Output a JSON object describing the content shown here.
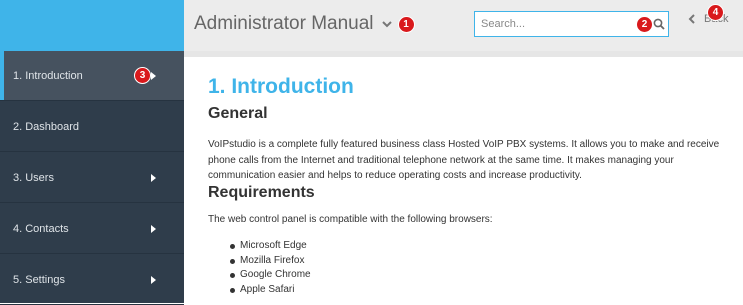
{
  "header": {
    "title": "Administrator Manual",
    "search_placeholder": "Search...",
    "back_label": "Back"
  },
  "badges": [
    "1",
    "2",
    "3",
    "4"
  ],
  "sidebar": {
    "items": [
      {
        "label": "1. Introduction",
        "active": true,
        "has_arrow": true
      },
      {
        "label": "2. Dashboard",
        "active": false,
        "has_arrow": false
      },
      {
        "label": "3. Users",
        "active": false,
        "has_arrow": true
      },
      {
        "label": "4. Contacts",
        "active": false,
        "has_arrow": true
      },
      {
        "label": "5. Settings",
        "active": false,
        "has_arrow": true
      }
    ]
  },
  "content": {
    "title": "1. Introduction",
    "general_heading": "General",
    "general_text": "VoIPstudio is a complete fully featured business class Hosted VoIP PBX systems. It allows you to make and receive phone calls from the Internet and traditional telephone network at the same time. It makes managing your communication easier and helps to reduce operating costs and increase productivity.",
    "requirements_heading": "Requirements",
    "requirements_text": "The web control panel is compatible with the following browsers:",
    "browsers": [
      "Microsoft Edge",
      "Mozilla Firefox",
      "Google Chrome",
      "Apple Safari"
    ]
  },
  "colors": {
    "accent": "#3fb4e9",
    "sidebar_bg": "#2f3d4b",
    "sidebar_active": "#46525f",
    "badge": "#d9191c"
  },
  "icons": [
    "chevron-down-icon",
    "search-icon",
    "chevron-left-icon",
    "chevron-right-icon"
  ]
}
